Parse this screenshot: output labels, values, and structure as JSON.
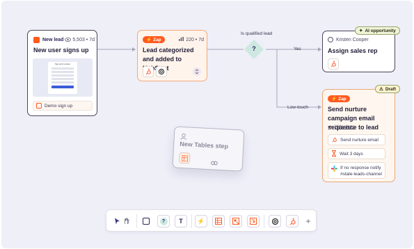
{
  "colors": {
    "canvas": "#efeff8",
    "zap_orange": "#ff5a1f",
    "card_border": "#4a4458",
    "connector": "#a8a5b8"
  },
  "trigger": {
    "label": "New lead",
    "views": "5,503 • 7d",
    "title": "New user signs up",
    "preview_heading": "Sign up for a demo",
    "form_label": "Demo sign up",
    "icons": [
      "form-icon",
      "eye-icon"
    ]
  },
  "zap_step": {
    "pill": "Zap",
    "stats": "220 • 7d",
    "title": "Lead categorized and added to HubSpot",
    "icons": [
      "hubspot-icon",
      "chatgpt-icon",
      "chevron-updown-icon"
    ]
  },
  "condition": {
    "label": "Is qualified lead",
    "symbol": "?"
  },
  "branches": {
    "yes": "Yes",
    "low_touch": "Low-touch"
  },
  "assign": {
    "badge": "AI opportunity",
    "person": "Kristen Cooper",
    "title": "Assign sales rep",
    "icons": [
      "sparkle-icon",
      "avatar-icon",
      "hubspot-icon"
    ]
  },
  "nurture": {
    "pill": "Zap",
    "badge": "Draft",
    "title": "Send nurture campaign email sequence to lead",
    "hide_steps": "Hide steps",
    "steps": [
      "Send nurture email",
      "Wait 3 days",
      "If no response notify #stale-leads-channel"
    ],
    "icons": [
      "warning-icon",
      "hubspot-icon",
      "hourglass-icon",
      "slack-icon"
    ]
  },
  "tables_step": {
    "title": "New Tables step",
    "icons": [
      "user-icon",
      "table-icon",
      "link-icon"
    ]
  },
  "toolbar": {
    "tools": [
      "cursor-icon",
      "hand-icon",
      "square-icon",
      "help-icon",
      "text-icon",
      "zap-icon",
      "table-icon",
      "interface-icon",
      "canvas-icon",
      "chatgpt-icon",
      "hubspot-icon",
      "plus-icon"
    ],
    "text_tool": "T",
    "help_tool": "?",
    "add": "+"
  }
}
